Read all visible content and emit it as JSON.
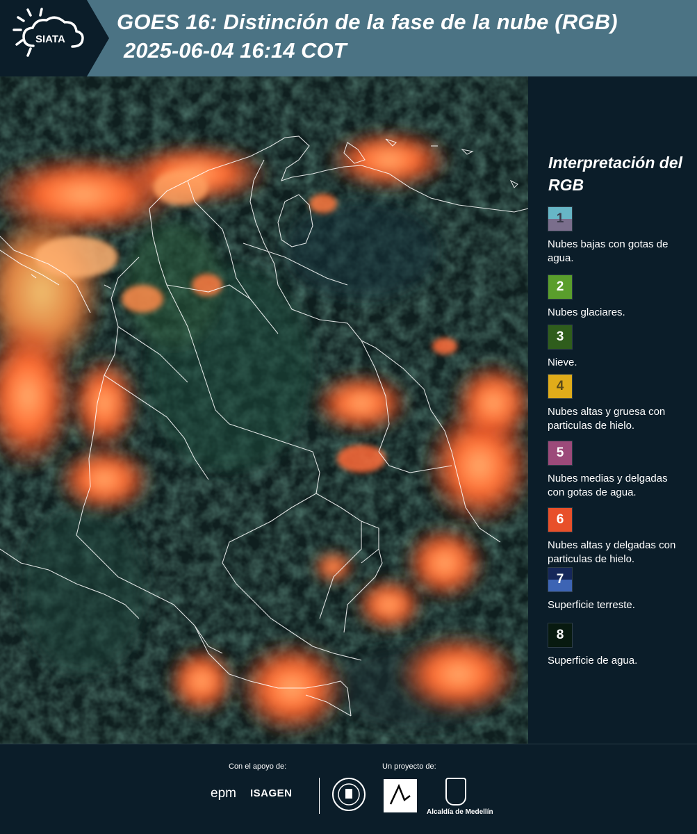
{
  "header": {
    "logo_text": "SIATA",
    "title": "GOES 16: Distinción de la fase de la nube (RGB)",
    "timestamp": "2025-06-04 16:14 COT"
  },
  "map": {
    "description_icon": "satellite-rgb-map",
    "cloud_color": "#ff5a2a",
    "border_color": "#ffffff"
  },
  "legend": {
    "title": "Interpretación del RGB",
    "items": [
      {
        "number": "1",
        "label": "Nubes bajas con gotas de agua.",
        "color_top": "#67b6c6",
        "color_bottom": "#7a6e8c",
        "num_color": "#3a3a4a"
      },
      {
        "number": "2",
        "label": "Nubes glaciares.",
        "color_top": "#5a9e2c",
        "color_bottom": "#5a9e2c",
        "num_color": "#ffffff"
      },
      {
        "number": "3",
        "label": "Nieve.",
        "color_top": "#2f5d1c",
        "color_bottom": "#2f5d1c",
        "num_color": "#ffffff"
      },
      {
        "number": "4",
        "label": "Nubes altas y gruesa con particulas de hielo.",
        "color_top": "#e0ac1a",
        "color_bottom": "#e0ac1a",
        "num_color": "#5a4a1a"
      },
      {
        "number": "5",
        "label": "Nubes medias y delgadas con gotas de agua.",
        "color_top": "#9c4a7a",
        "color_bottom": "#9c4a7a",
        "num_color": "#ffffff"
      },
      {
        "number": "6",
        "label": "Nubes altas y delgadas con particulas de hielo.",
        "color_top": "#e8502a",
        "color_bottom": "#e8502a",
        "num_color": "#ffffff"
      },
      {
        "number": "7",
        "label": "Superficie terreste.",
        "color_top": "#16275a",
        "color_bottom": "#3d64b4",
        "num_color": "#ffffff"
      },
      {
        "number": "8",
        "label": "Superficie de agua.",
        "color_top": "#081a10",
        "color_bottom": "#081a10",
        "num_color": "#ffffff"
      }
    ]
  },
  "footer": {
    "support_label": "Con el apoyo de:",
    "project_label": "Un proyecto de:",
    "epm": "epm",
    "isagen": "ISAGEN",
    "medellin": "Alcaldía de Medellín"
  }
}
